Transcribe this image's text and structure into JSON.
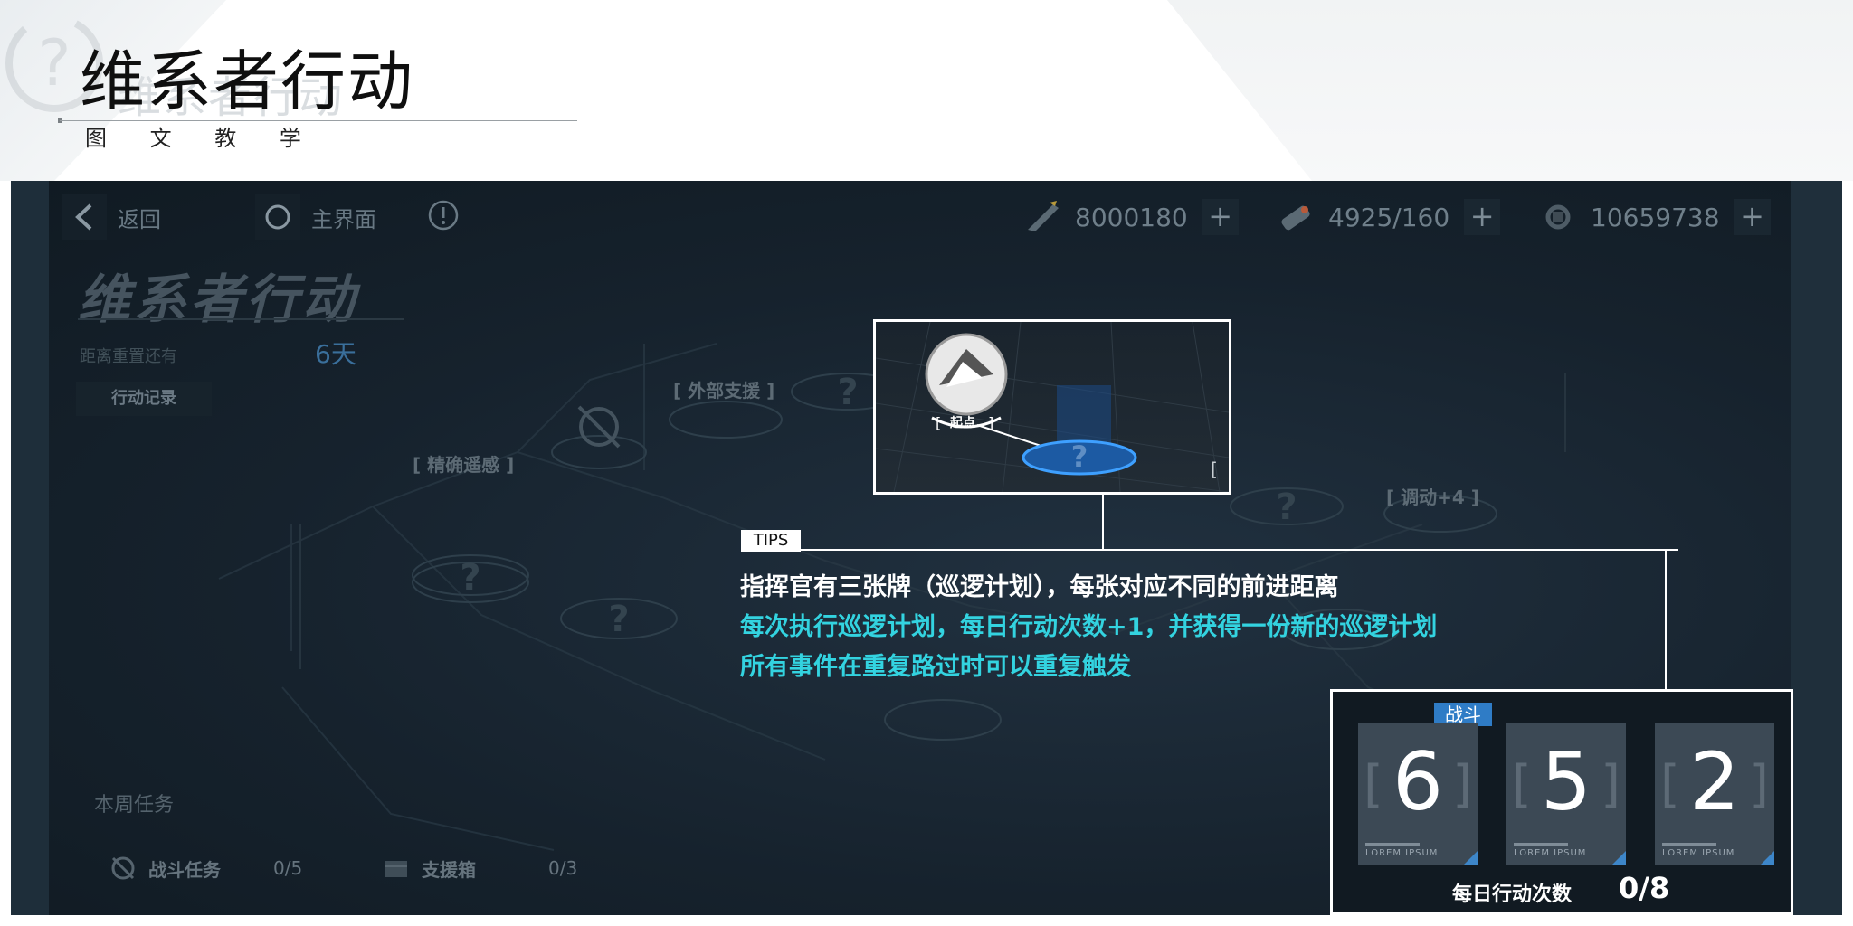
{
  "header": {
    "title": "维系者行动",
    "subtitle": "图 文 教 学"
  },
  "game": {
    "top_bar": {
      "back_label": "返回",
      "home_label": "主界面",
      "resources": [
        {
          "icon": "rifle-icon",
          "value": "8000180"
        },
        {
          "icon": "fuel-icon",
          "value": "4925/160"
        },
        {
          "icon": "gear-part-icon",
          "value": "10659738"
        }
      ],
      "plus_symbol": "+"
    },
    "title": "维系者行动",
    "reset_label": "距离重置还有",
    "reset_value": "6天",
    "record_button": "行动记录",
    "map_nodes": {
      "precise_sensing": "[ 精确遥感 ]",
      "external_support": "[ 外部支援 ]",
      "mobilize": "[ 调动+4 ]",
      "unknown": "?"
    },
    "weekly": {
      "title": "本周任务",
      "tasks": [
        {
          "name": "战斗任务",
          "value": "0/5"
        },
        {
          "name": "支援箱",
          "value": "0/3"
        }
      ]
    }
  },
  "tutorial": {
    "start_label": "起点",
    "tips_tag": "TIPS",
    "lines": [
      "指挥官有三张牌（巡逻计划），每张对应不同的前进距离",
      "每次执行巡逻计划，每日行动次数+1，并获得一份新的巡逻计划",
      "所有事件在重复路过时可以重复触发"
    ],
    "cards_panel": {
      "badge": "战斗",
      "cards": [
        {
          "number": "6",
          "caption": "LOREM IPSUM"
        },
        {
          "number": "5",
          "caption": "LOREM IPSUM"
        },
        {
          "number": "2",
          "caption": "LOREM IPSUM"
        }
      ],
      "daily_label": "每日行动次数",
      "daily_value": "0/8"
    }
  },
  "colors": {
    "highlight_cyan": "#33d3e0",
    "badge_blue": "#2f7cc6",
    "background_dark": "#16222d"
  }
}
